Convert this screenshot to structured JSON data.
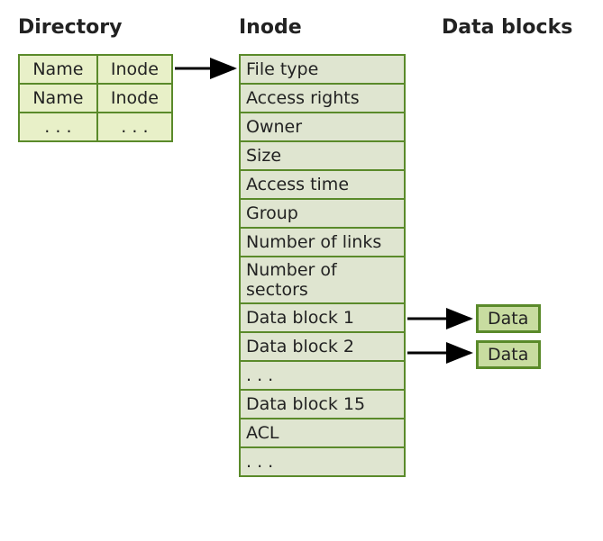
{
  "headings": {
    "directory": "Directory",
    "inode": "Inode",
    "datablocks": "Data blocks"
  },
  "directory": {
    "rows": [
      {
        "name": "Name",
        "inode": "Inode"
      },
      {
        "name": "Name",
        "inode": "Inode"
      },
      {
        "name": ". . .",
        "inode": ". . ."
      }
    ]
  },
  "inode": {
    "rows": [
      "File type",
      "Access rights",
      "Owner",
      "Size",
      "Access time",
      "Group",
      "Number of links",
      "Number of sectors",
      "Data block 1",
      "Data block 2",
      ". . .",
      "Data block 15",
      "ACL",
      ". . ."
    ]
  },
  "datablocks": {
    "items": [
      "Data",
      "Data"
    ]
  }
}
